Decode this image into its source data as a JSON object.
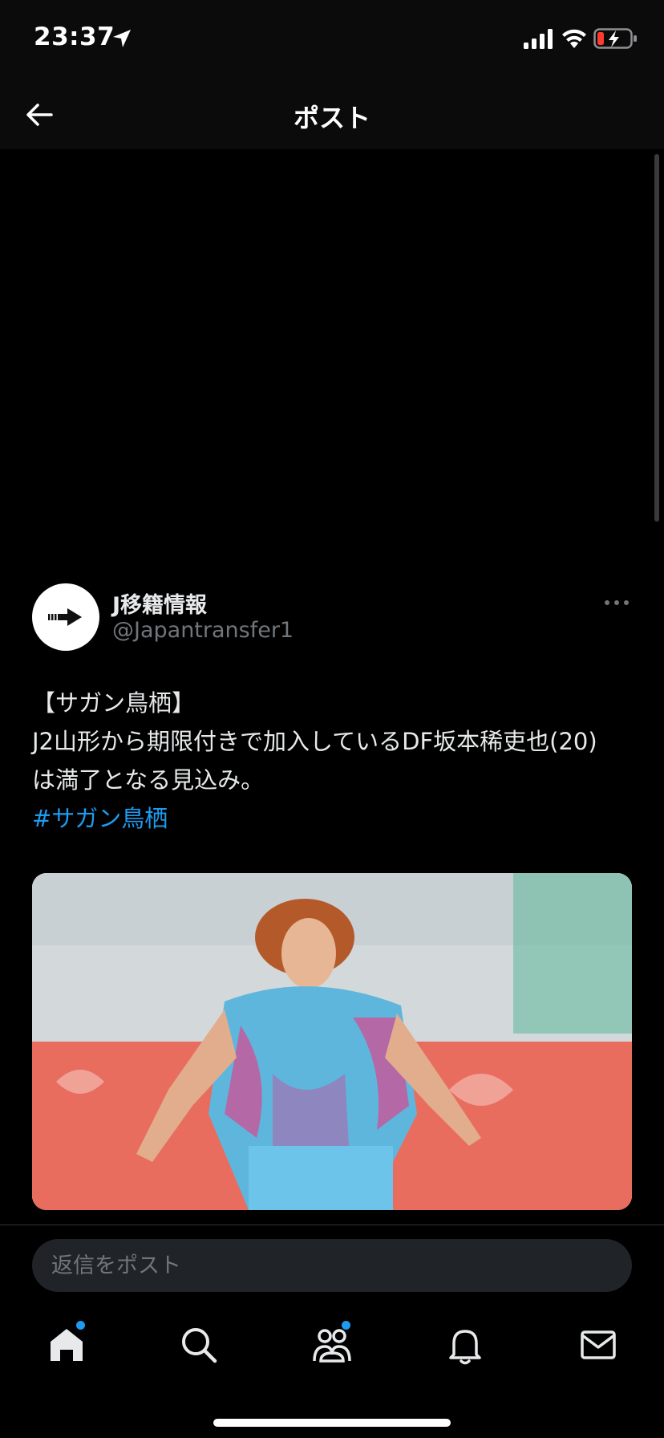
{
  "status_bar": {
    "time": "23:37",
    "icons": [
      "location-arrow-icon",
      "signal-icon",
      "wifi-icon",
      "battery-low-charging-icon"
    ]
  },
  "header": {
    "title": "ポスト",
    "back_icon": "back-arrow-icon"
  },
  "post": {
    "author": {
      "display_name": "J移籍情報",
      "handle": "@Japantransfer1",
      "avatar_icon": "arrow-right-logo"
    },
    "more_icon": "more-dots-icon",
    "text_lines": [
      "【サガン鳥栖】",
      "J2山形から期限付きで加入しているDF坂本稀吏也(20)",
      "は満了となる見込み。"
    ],
    "hashtag": "#サガン鳥栖",
    "media": {
      "description_icon": "photo"
    }
  },
  "reply": {
    "placeholder": "返信をポスト"
  },
  "tabbar": {
    "items": [
      {
        "name": "home",
        "icon": "home-icon",
        "dot": true
      },
      {
        "name": "search",
        "icon": "search-icon",
        "dot": false
      },
      {
        "name": "communities",
        "icon": "communities-icon",
        "dot": true
      },
      {
        "name": "notifications",
        "icon": "bell-icon",
        "dot": false
      },
      {
        "name": "messages",
        "icon": "mail-icon",
        "dot": false
      }
    ]
  },
  "colors": {
    "background": "#000000",
    "text": "#e7e9ea",
    "muted": "#71767b",
    "accent": "#1d9bf0"
  }
}
